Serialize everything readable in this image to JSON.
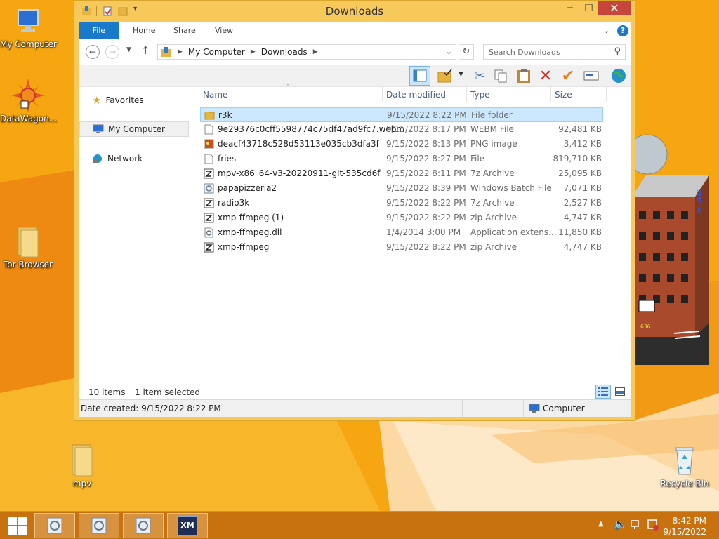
{
  "desktop": {
    "icons": [
      {
        "label": "My Computer"
      },
      {
        "label": "DataWagon..."
      },
      {
        "label": "Tor Browser"
      },
      {
        "label": "mpv"
      },
      {
        "label": "Recycle Bin"
      }
    ],
    "wallpaper_sign": "XMPLAY",
    "building_number": "636"
  },
  "window": {
    "title": "Downloads",
    "controls": {
      "minimize": "─",
      "maximize": "☐",
      "close": "✕"
    }
  },
  "ribbon": {
    "tabs": [
      "File",
      "Home",
      "Share",
      "View"
    ],
    "help": "?"
  },
  "address": {
    "path": [
      "My Computer",
      "Downloads"
    ],
    "search_placeholder": "Search Downloads"
  },
  "nav_pane": {
    "items": [
      "Favorites",
      "My Computer",
      "Network"
    ]
  },
  "columns": [
    "Name",
    "Date modified",
    "Type",
    "Size"
  ],
  "files": [
    {
      "name": "r3k",
      "date": "9/15/2022 8:22 PM",
      "type": "File folder",
      "size": "",
      "icon": "folder-icon"
    },
    {
      "name": "9e29376c0cff5598774c75df47ad9fc7.webm",
      "date": "9/15/2022 8:17 PM",
      "type": "WEBM File",
      "size": "92,481 KB",
      "icon": "blank-file-icon"
    },
    {
      "name": "deacf43718c528d53113e035cb3dfa3f",
      "date": "9/15/2022 8:13 PM",
      "type": "PNG image",
      "size": "3,412 KB",
      "icon": "image-file-icon"
    },
    {
      "name": "fries",
      "date": "9/15/2022 8:27 PM",
      "type": "File",
      "size": "819,710 KB",
      "icon": "blank-file-icon"
    },
    {
      "name": "mpv-x86_64-v3-20220911-git-535cd6f",
      "date": "9/15/2022 8:11 PM",
      "type": "7z Archive",
      "size": "25,095 KB",
      "icon": "archive-icon"
    },
    {
      "name": "papapizzeria2",
      "date": "9/15/2022 8:39 PM",
      "type": "Windows Batch File",
      "size": "7,071 KB",
      "icon": "batch-file-icon"
    },
    {
      "name": "radio3k",
      "date": "9/15/2022 8:22 PM",
      "type": "7z Archive",
      "size": "2,527 KB",
      "icon": "archive-icon"
    },
    {
      "name": "xmp-ffmpeg (1)",
      "date": "9/15/2022 8:22 PM",
      "type": "zip Archive",
      "size": "4,747 KB",
      "icon": "archive-icon"
    },
    {
      "name": "xmp-ffmpeg.dll",
      "date": "1/4/2014 3:00 PM",
      "type": "Application extens...",
      "size": "11,850 KB",
      "icon": "dll-file-icon"
    },
    {
      "name": "xmp-ffmpeg",
      "date": "9/15/2022 8:22 PM",
      "type": "zip Archive",
      "size": "4,747 KB",
      "icon": "archive-icon"
    }
  ],
  "selected_index": 0,
  "status": {
    "items_count": "10 items",
    "selected_text": "1 item selected"
  },
  "details": {
    "date_created": "Date created: 9/15/2022 8:22 PM",
    "location": "Computer"
  },
  "taskbar": {
    "time": "8:42 PM",
    "date": "9/15/2022",
    "xmplay_label": "XM"
  },
  "colors": {
    "accent": "#1979ca",
    "selection": "#cce8ff",
    "window_frame": "#f6c95a",
    "desktop": "#f5a20f",
    "taskbar": "#c8720f"
  }
}
